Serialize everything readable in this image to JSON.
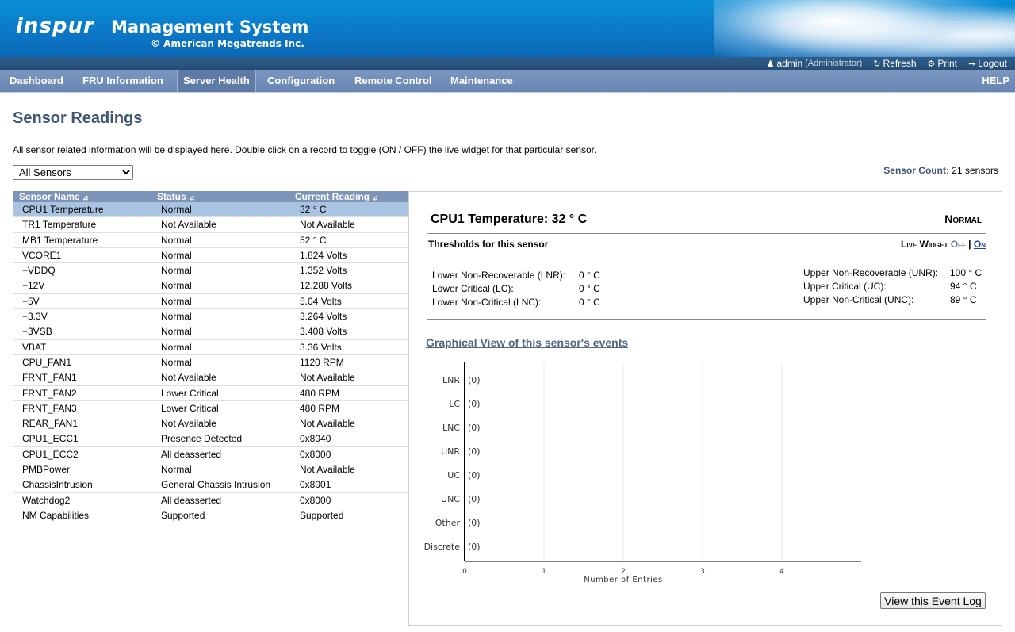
{
  "header": {
    "logo": "inspur",
    "title": "Management System",
    "copyright": "© American Megatrends Inc.",
    "user": "admin",
    "role": "(Administrator)",
    "refresh": "Refresh",
    "print": "Print",
    "logout": "Logout"
  },
  "nav": {
    "items": [
      "Dashboard",
      "FRU Information",
      "Server Health",
      "Configuration",
      "Remote Control",
      "Maintenance"
    ],
    "active": "Server Health",
    "help": "HELP"
  },
  "page": {
    "title": "Sensor Readings",
    "description": "All sensor related information will be displayed here. Double click on a record to toggle (ON / OFF) the live widget for that particular sensor.",
    "filter_selected": "All Sensors",
    "sensor_count_label": "Sensor Count:",
    "sensor_count_value": "21 sensors"
  },
  "table": {
    "headers": [
      "Sensor Name",
      "Status",
      "Current Reading"
    ],
    "sort_icon": "sort-arrow-icon",
    "rows": [
      [
        "CPU1 Temperature",
        "Normal",
        "32 ° C"
      ],
      [
        "TR1 Temperature",
        "Not Available",
        "Not Available"
      ],
      [
        "MB1 Temperature",
        "Normal",
        "52 ° C"
      ],
      [
        "VCORE1",
        "Normal",
        "1.824 Volts"
      ],
      [
        "+VDDQ",
        "Normal",
        "1.352 Volts"
      ],
      [
        "+12V",
        "Normal",
        "12.288 Volts"
      ],
      [
        "+5V",
        "Normal",
        "5.04 Volts"
      ],
      [
        "+3.3V",
        "Normal",
        "3.264 Volts"
      ],
      [
        "+3VSB",
        "Normal",
        "3.408 Volts"
      ],
      [
        "VBAT",
        "Normal",
        "3.36 Volts"
      ],
      [
        "CPU_FAN1",
        "Normal",
        "1120 RPM"
      ],
      [
        "FRNT_FAN1",
        "Not Available",
        "Not Available"
      ],
      [
        "FRNT_FAN2",
        "Lower Critical",
        "480 RPM"
      ],
      [
        "FRNT_FAN3",
        "Lower Critical",
        "480 RPM"
      ],
      [
        "REAR_FAN1",
        "Not Available",
        "Not Available"
      ],
      [
        "CPU1_ECC1",
        "Presence Detected",
        "0x8040"
      ],
      [
        "CPU1_ECC2",
        "All deasserted",
        "0x8000"
      ],
      [
        "PMBPower",
        "Normal",
        "Not Available"
      ],
      [
        "ChassisIntrusion",
        "General Chassis Intrusion",
        "0x8001"
      ],
      [
        "Watchdog2",
        "All deasserted",
        "0x8000"
      ],
      [
        "NM Capabilities",
        "Supported",
        "Supported"
      ]
    ],
    "selected_index": 0
  },
  "detail": {
    "sensor_title": "CPU1 Temperature: 32 ° C",
    "status": "Normal",
    "thresholds_label": "Thresholds for this sensor",
    "live_widget_label": "Live Widget",
    "live_off": "Off",
    "live_sep": "|",
    "live_on": "On",
    "lower": [
      {
        "label": "Lower Non-Recoverable (LNR):",
        "value": "0 ° C"
      },
      {
        "label": "Lower Critical (LC):",
        "value": "0 ° C"
      },
      {
        "label": "Lower Non-Critical (LNC):",
        "value": "0 ° C"
      }
    ],
    "upper": [
      {
        "label": "Upper Non-Recoverable (UNR):",
        "value": "100 ° C"
      },
      {
        "label": "Upper Critical (UC):",
        "value": "94 ° C"
      },
      {
        "label": "Upper Non-Critical (UNC):",
        "value": "89 ° C"
      }
    ],
    "graph_link": "Graphical View of this sensor's events",
    "view_log_button": "View this Event Log"
  },
  "chart_data": {
    "type": "bar",
    "orientation": "horizontal",
    "categories": [
      "LNR",
      "LC",
      "LNC",
      "UNR",
      "UC",
      "UNC",
      "Other",
      "Discrete"
    ],
    "values": [
      0,
      0,
      0,
      0,
      0,
      0,
      0,
      0
    ],
    "value_labels": [
      "(0)",
      "(0)",
      "(0)",
      "(0)",
      "(0)",
      "(0)",
      "(0)",
      "(0)"
    ],
    "xlabel": "Number of Entries",
    "xticks": [
      "0",
      "1",
      "2",
      "3",
      "4"
    ],
    "xlim": [
      0,
      5
    ],
    "grid": true
  }
}
